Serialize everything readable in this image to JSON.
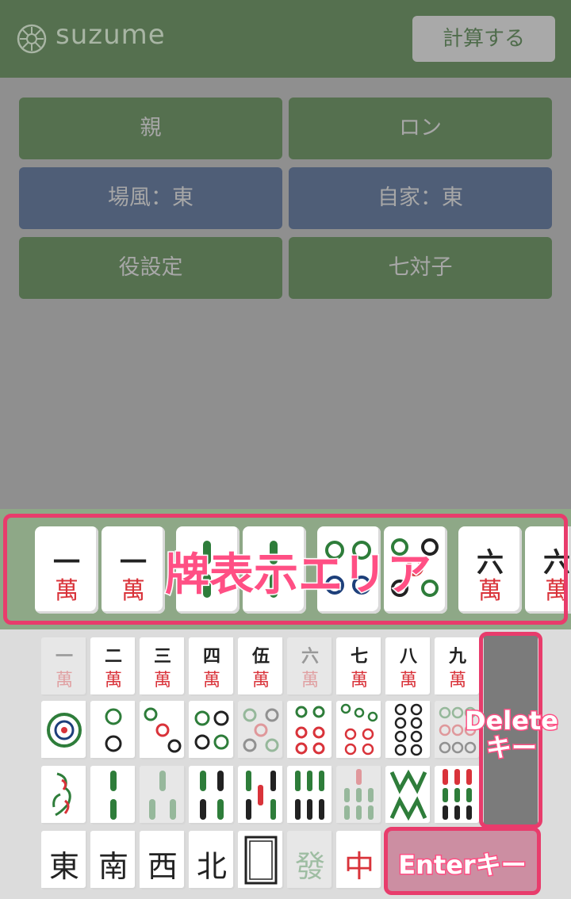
{
  "app": {
    "name": "suzume",
    "calc_button": "計算する"
  },
  "options": [
    {
      "label": "親"
    },
    {
      "label": "ロン"
    },
    {
      "label": "場風：東"
    },
    {
      "label": "自家：東"
    },
    {
      "label": "役設定"
    },
    {
      "label": "七対子"
    }
  ],
  "tile_area": {
    "label": "牌表示エリア",
    "tiles": [
      {
        "top": "一",
        "bottom": "萬"
      },
      {
        "top": "一",
        "bottom": "萬"
      },
      {
        "kind": "bamboo-2"
      },
      {
        "kind": "bamboo-2"
      },
      {
        "kind": "circle-4"
      },
      {
        "kind": "circle-5"
      },
      {
        "top": "六",
        "bottom": "萬"
      },
      {
        "top": "六",
        "bottom": "萬"
      }
    ]
  },
  "keyboard": {
    "manzu": [
      {
        "top": "一",
        "bottom": "萬",
        "dim": true
      },
      {
        "top": "二",
        "bottom": "萬"
      },
      {
        "top": "三",
        "bottom": "萬"
      },
      {
        "top": "四",
        "bottom": "萬"
      },
      {
        "top": "伍",
        "bottom": "萬"
      },
      {
        "top": "六",
        "bottom": "萬",
        "dim": true
      },
      {
        "top": "七",
        "bottom": "萬"
      },
      {
        "top": "八",
        "bottom": "萬"
      },
      {
        "top": "九",
        "bottom": "萬"
      }
    ],
    "pinzu": [
      1,
      2,
      3,
      4,
      5,
      6,
      7,
      8,
      9
    ],
    "souzu": [
      1,
      2,
      3,
      4,
      5,
      6,
      7,
      8,
      9
    ],
    "honors": [
      "東",
      "南",
      "西",
      "北",
      "白",
      "發",
      "中"
    ],
    "delete_label": "Delete\nキー",
    "delete_label_line1": "Delete",
    "delete_label_line2": "キー",
    "enter_label": "Enterキー"
  },
  "colors": {
    "header": "#55704f",
    "blue": "#4f5e77",
    "highlight": "#e83c6c"
  }
}
